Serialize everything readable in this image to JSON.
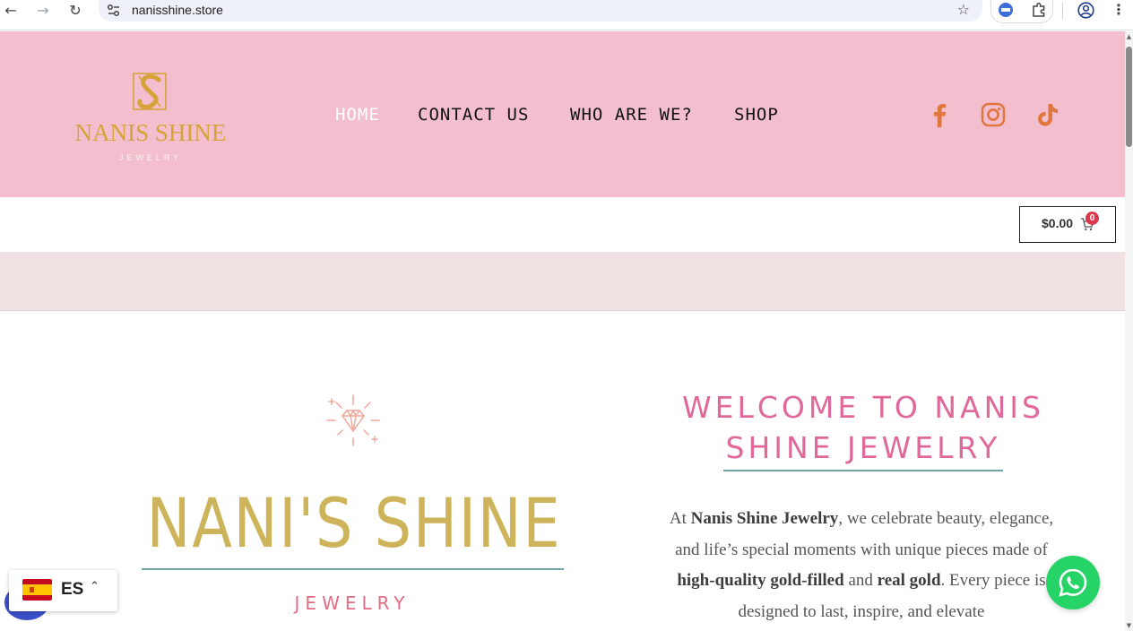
{
  "browser": {
    "url": "nanisshine.store"
  },
  "header": {
    "logo_name": "NANIS SHINE",
    "logo_sub": "JEWELRY",
    "menu": [
      {
        "label": "HOME",
        "active": true
      },
      {
        "label": "CONTACT US",
        "active": false
      },
      {
        "label": "WHO ARE WE?",
        "active": false
      },
      {
        "label": "SHOP",
        "active": false
      }
    ],
    "social_icons": [
      "facebook-icon",
      "instagram-icon",
      "tiktok-icon"
    ],
    "background": "#f3bfcf",
    "social_color": "#e0773f"
  },
  "cart": {
    "total": "$0.00",
    "count": "0"
  },
  "hero": {
    "title": "NANI'S SHINE",
    "subtitle": "JEWELRY",
    "welcome_line1": "WELCOME TO NANIS",
    "welcome_line2": "SHINE JEWELRY",
    "intro_parts": [
      {
        "text": "At ",
        "bold": false
      },
      {
        "text": "Nanis Shine Jewelry",
        "bold": true
      },
      {
        "text": ", we celebrate beauty, elegance, and life’s special moments with unique pieces made of ",
        "bold": false
      },
      {
        "text": "high-quality gold-filled",
        "bold": true
      },
      {
        "text": " and ",
        "bold": false
      },
      {
        "text": "real gold",
        "bold": true
      },
      {
        "text": ". Every piece is designed to last, inspire, and elevate",
        "bold": false
      }
    ],
    "title_color": "#cdb35a",
    "accent_color": "#e0689a"
  },
  "language_switcher": {
    "code": "ES",
    "flag": "spain-flag-icon"
  },
  "whatsapp": {
    "icon": "whatsapp-icon",
    "color": "#25d366"
  }
}
